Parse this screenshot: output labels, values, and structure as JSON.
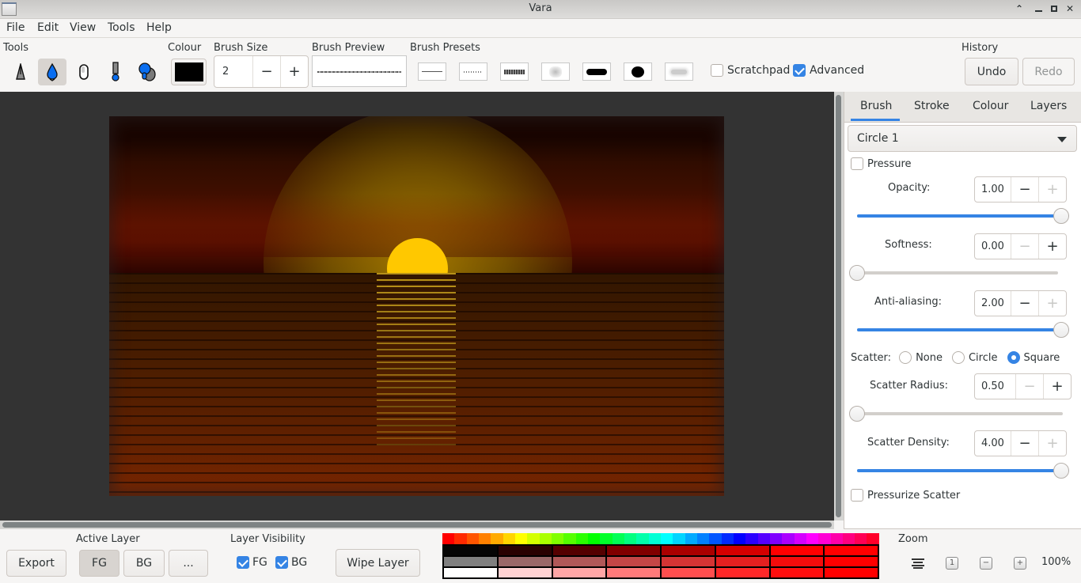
{
  "window": {
    "title": "Vara",
    "controls": [
      "up-icon",
      "minimize-icon",
      "maximize-icon",
      "close-icon"
    ]
  },
  "menu": [
    "File",
    "Edit",
    "View",
    "Tools",
    "Help"
  ],
  "toolbar": {
    "tools_label": "Tools",
    "tools": [
      {
        "name": "pen-nib-tool",
        "active": false
      },
      {
        "name": "ink-drop-tool",
        "active": true
      },
      {
        "name": "eraser-tool",
        "active": false
      },
      {
        "name": "marker-tool",
        "active": false
      },
      {
        "name": "blend-tool",
        "active": false
      }
    ],
    "colour_label": "Colour",
    "colour_value": "#000000",
    "brush_size_label": "Brush Size",
    "brush_size_value": "2",
    "brush_preview_label": "Brush Preview",
    "brush_presets_label": "Brush Presets",
    "presets": [
      "thin-line",
      "scatter-line",
      "scatter-blob",
      "soft-spray",
      "thick-stroke",
      "round-dot",
      "blur-stroke"
    ],
    "scratchpad_label": "Scratchpad",
    "scratchpad_checked": false,
    "advanced_label": "Advanced",
    "advanced_checked": true,
    "history_label": "History",
    "undo_label": "Undo",
    "redo_label": "Redo",
    "redo_enabled": false
  },
  "panel": {
    "tabs": [
      "Brush",
      "Stroke",
      "Colour",
      "Layers"
    ],
    "active_tab": "Brush",
    "brush_select": "Circle 1",
    "pressure_label": "Pressure",
    "pressure_checked": false,
    "opacity": {
      "label": "Opacity:",
      "value": "1.00",
      "fraction": 1.0
    },
    "softness": {
      "label": "Softness:",
      "value": "0.00",
      "fraction": 0.0
    },
    "antialiasing": {
      "label": "Anti-aliasing:",
      "value": "2.00",
      "fraction": 1.0
    },
    "scatter_label": "Scatter:",
    "scatter_options": [
      "None",
      "Circle",
      "Square"
    ],
    "scatter_selected": "Square",
    "scatter_radius": {
      "label": "Scatter Radius:",
      "value": "0.50",
      "fraction": 0.0
    },
    "scatter_density": {
      "label": "Scatter Density:",
      "value": "4.00",
      "fraction": 1.0
    },
    "pressurize_scatter_label": "Pressurize Scatter",
    "pressurize_scatter_checked": false
  },
  "bottom": {
    "export_label": "Export",
    "active_layer_label": "Active Layer",
    "fg_label": "FG",
    "bg_label": "BG",
    "more_label": "...",
    "active_layer": "FG",
    "layer_visibility_label": "Layer Visibility",
    "fg_visible": true,
    "bg_visible": true,
    "wipe_label": "Wipe Layer",
    "zoom_label": "Zoom",
    "zoom_value": "100%"
  },
  "palette": {
    "hues": [
      "#ff0000",
      "#ff2a00",
      "#ff5500",
      "#ff8000",
      "#ffaa00",
      "#ffd500",
      "#ffff00",
      "#d4ff00",
      "#aaff00",
      "#80ff00",
      "#55ff00",
      "#2aff00",
      "#00ff00",
      "#00ff2a",
      "#00ff55",
      "#00ff80",
      "#00ffaa",
      "#00ffd5",
      "#00ffff",
      "#00d5ff",
      "#00aaff",
      "#0080ff",
      "#0055ff",
      "#002aff",
      "#0000ff",
      "#2a00ff",
      "#5500ff",
      "#8000ff",
      "#aa00ff",
      "#d500ff",
      "#ff00ff",
      "#ff00d5",
      "#ff00aa",
      "#ff0080",
      "#ff0055",
      "#ff002a"
    ],
    "dark": [
      "#050505",
      "#180303",
      "#2a0202",
      "#3f0101",
      "#550101",
      "#6a0101",
      "#800000",
      "#950000",
      "#aa0000",
      "#bf0000",
      "#d50000",
      "#ea0000",
      "#ff0000",
      "#ff0000",
      "#ff0000",
      "#ff0000"
    ],
    "mid": [
      "#808080",
      "#8c7272",
      "#9a6868",
      "#a56060",
      "#b05858",
      "#ba4e4e",
      "#c44646",
      "#cc3c3c",
      "#d43434",
      "#dc2a2a",
      "#e42020",
      "#ec1616",
      "#f40c0c",
      "#ff0000",
      "#ff0000",
      "#ff0000"
    ],
    "light": [
      "#ffffff",
      "#ffe8e8",
      "#ffd2d2",
      "#ffbcbc",
      "#ffa6a6",
      "#ff9090",
      "#ff7a7a",
      "#ff6464",
      "#ff4e4e",
      "#ff3a3a",
      "#ff2828",
      "#ff1a1a",
      "#ff0e0e",
      "#ff0000",
      "#ff0000",
      "#ff0000"
    ]
  }
}
